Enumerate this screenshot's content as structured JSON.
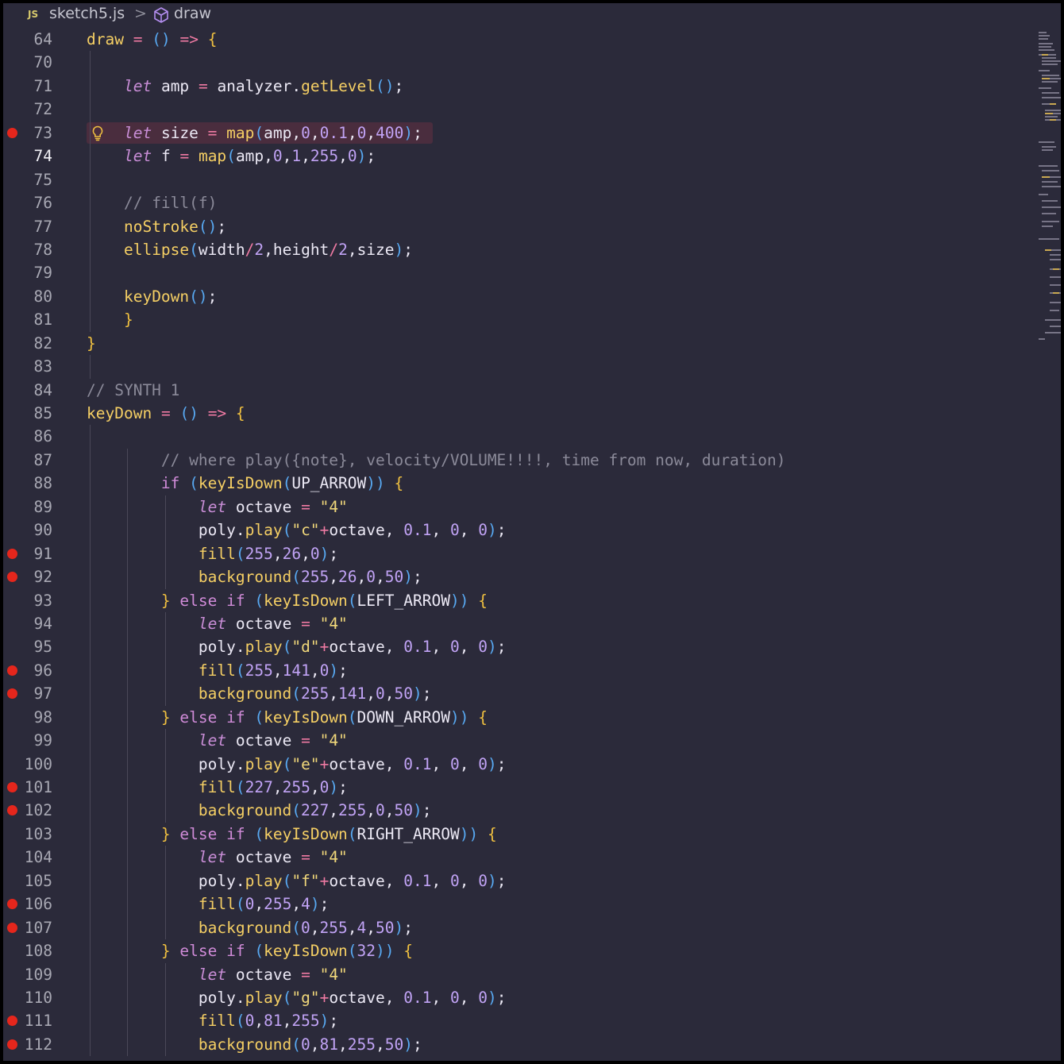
{
  "breadcrumb": {
    "file_badge": "JS",
    "file_name": "sketch5.js",
    "separator": ">",
    "symbol_icon": "symbol-method-icon",
    "symbol_name": "draw"
  },
  "colors": {
    "editor_background": "#2b2a3a",
    "breakpoint": "#e5261c",
    "current_line_highlight": "#4a2d3e",
    "lightbulb": "#f0c040"
  },
  "editor": {
    "active_line": "74",
    "lightbulb_line": "73",
    "lines": [
      {
        "n": "64",
        "text": "draw = () => {",
        "bp": false
      },
      {
        "n": "70",
        "text": "",
        "bp": false
      },
      {
        "n": "71",
        "text": "    let amp = analyzer.getLevel();",
        "bp": false
      },
      {
        "n": "72",
        "text": "",
        "bp": false
      },
      {
        "n": "73",
        "text": "    let size = map(amp,0,0.1,0,400);",
        "bp": true
      },
      {
        "n": "74",
        "text": "    let f = map(amp,0,1,255,0);",
        "bp": false
      },
      {
        "n": "75",
        "text": "",
        "bp": false
      },
      {
        "n": "76",
        "text": "    // fill(f)",
        "bp": false
      },
      {
        "n": "77",
        "text": "    noStroke();",
        "bp": false
      },
      {
        "n": "78",
        "text": "    ellipse(width/2,height/2,size);",
        "bp": false
      },
      {
        "n": "79",
        "text": "",
        "bp": false
      },
      {
        "n": "80",
        "text": "    keyDown();",
        "bp": false
      },
      {
        "n": "81",
        "text": "    }",
        "bp": false
      },
      {
        "n": "82",
        "text": "}",
        "bp": false
      },
      {
        "n": "83",
        "text": "",
        "bp": false
      },
      {
        "n": "84",
        "text": "// SYNTH 1",
        "bp": false
      },
      {
        "n": "85",
        "text": "keyDown = () => {",
        "bp": false
      },
      {
        "n": "86",
        "text": "",
        "bp": false
      },
      {
        "n": "87",
        "text": "        // where play({note}, velocity/VOLUME!!!!, time from now, duration)",
        "bp": false
      },
      {
        "n": "88",
        "text": "        if (keyIsDown(UP_ARROW)) {",
        "bp": false
      },
      {
        "n": "89",
        "text": "            let octave = \"4\"",
        "bp": false
      },
      {
        "n": "90",
        "text": "            poly.play(\"c\"+octave, 0.1, 0, 0);",
        "bp": false
      },
      {
        "n": "91",
        "text": "            fill(255,26,0);",
        "bp": true
      },
      {
        "n": "92",
        "text": "            background(255,26,0,50);",
        "bp": true
      },
      {
        "n": "93",
        "text": "        } else if (keyIsDown(LEFT_ARROW)) {",
        "bp": false
      },
      {
        "n": "94",
        "text": "            let octave = \"4\"",
        "bp": false
      },
      {
        "n": "95",
        "text": "            poly.play(\"d\"+octave, 0.1, 0, 0);",
        "bp": false
      },
      {
        "n": "96",
        "text": "            fill(255,141,0);",
        "bp": true
      },
      {
        "n": "97",
        "text": "            background(255,141,0,50);",
        "bp": true
      },
      {
        "n": "98",
        "text": "        } else if (keyIsDown(DOWN_ARROW)) {",
        "bp": false
      },
      {
        "n": "99",
        "text": "            let octave = \"4\"",
        "bp": false
      },
      {
        "n": "100",
        "text": "            poly.play(\"e\"+octave, 0.1, 0, 0);",
        "bp": false
      },
      {
        "n": "101",
        "text": "            fill(227,255,0);",
        "bp": true
      },
      {
        "n": "102",
        "text": "            background(227,255,0,50);",
        "bp": true
      },
      {
        "n": "103",
        "text": "        } else if (keyIsDown(RIGHT_ARROW)) {",
        "bp": false
      },
      {
        "n": "104",
        "text": "            let octave = \"4\"",
        "bp": false
      },
      {
        "n": "105",
        "text": "            poly.play(\"f\"+octave, 0.1, 0, 0);",
        "bp": false
      },
      {
        "n": "106",
        "text": "            fill(0,255,4);",
        "bp": true
      },
      {
        "n": "107",
        "text": "            background(0,255,4,50);",
        "bp": true
      },
      {
        "n": "108",
        "text": "        } else if (keyIsDown(32)) {",
        "bp": false
      },
      {
        "n": "109",
        "text": "            let octave = \"4\"",
        "bp": false
      },
      {
        "n": "110",
        "text": "            poly.play(\"g\"+octave, 0.1, 0, 0);",
        "bp": false
      },
      {
        "n": "111",
        "text": "            fill(0,81,255);",
        "bp": true
      },
      {
        "n": "112",
        "text": "            background(0,81,255,50);",
        "bp": true
      }
    ]
  }
}
